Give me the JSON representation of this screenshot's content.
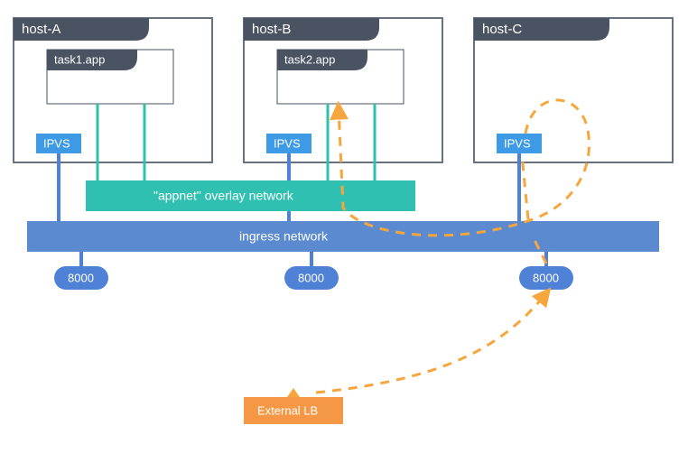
{
  "hosts": [
    {
      "label": "host-A",
      "task": "task1.app",
      "ipvs": "IPVS"
    },
    {
      "label": "host-B",
      "task": "task2.app",
      "ipvs": "IPVS"
    },
    {
      "label": "host-C",
      "task": null,
      "ipvs": "IPVS"
    }
  ],
  "overlay_label": "\"appnet\" overlay network",
  "ingress_label": "ingress network",
  "ports": [
    "8000",
    "8000",
    "8000"
  ],
  "external_label": "External LB",
  "colors": {
    "host_stroke": "#667281",
    "tab_fill": "#4a5361",
    "ipvs_fill": "#3f9ae5",
    "overlay_fill": "#2fc0b2",
    "ingress_fill": "#5b8ad0",
    "port_fill": "#4f82d6",
    "external_fill": "#f59846",
    "dash": "#f6a63d"
  }
}
